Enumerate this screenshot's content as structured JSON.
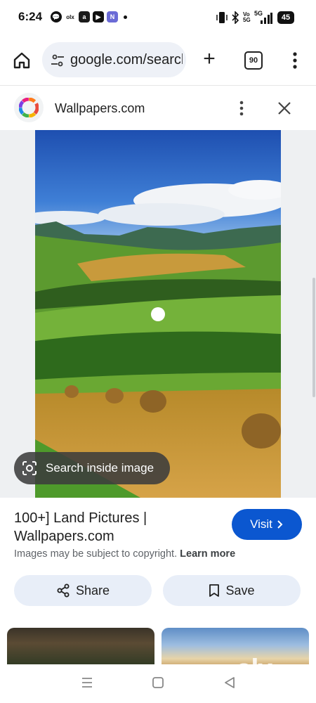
{
  "status_bar": {
    "time": "6:24",
    "network": "5G",
    "battery": "45",
    "left_icons": [
      "chat-icon",
      "olx-icon",
      "app-icon",
      "youtube-icon",
      "app2-icon",
      "dot-icon"
    ],
    "right_icons": [
      "vibrate-icon",
      "bluetooth-icon",
      "volte-icon",
      "signal-icon",
      "battery-icon"
    ]
  },
  "toolbar": {
    "url": "google.com/search",
    "tab_count": "90"
  },
  "site": {
    "name": "Wallpapers.com"
  },
  "image": {
    "lens_label": "Search inside image"
  },
  "result": {
    "title": "100+] Land Pictures | Wallpapers.com",
    "visit_label": "Visit",
    "copyright_text": "Images may be subject to copyright.",
    "learn_more": "Learn more",
    "share_label": "Share",
    "save_label": "Save"
  },
  "watermark": {
    "brand": "olx"
  },
  "colors": {
    "accent": "#0b57d0",
    "pill_bg": "#e8eef8",
    "url_bg": "#eef1f7"
  }
}
